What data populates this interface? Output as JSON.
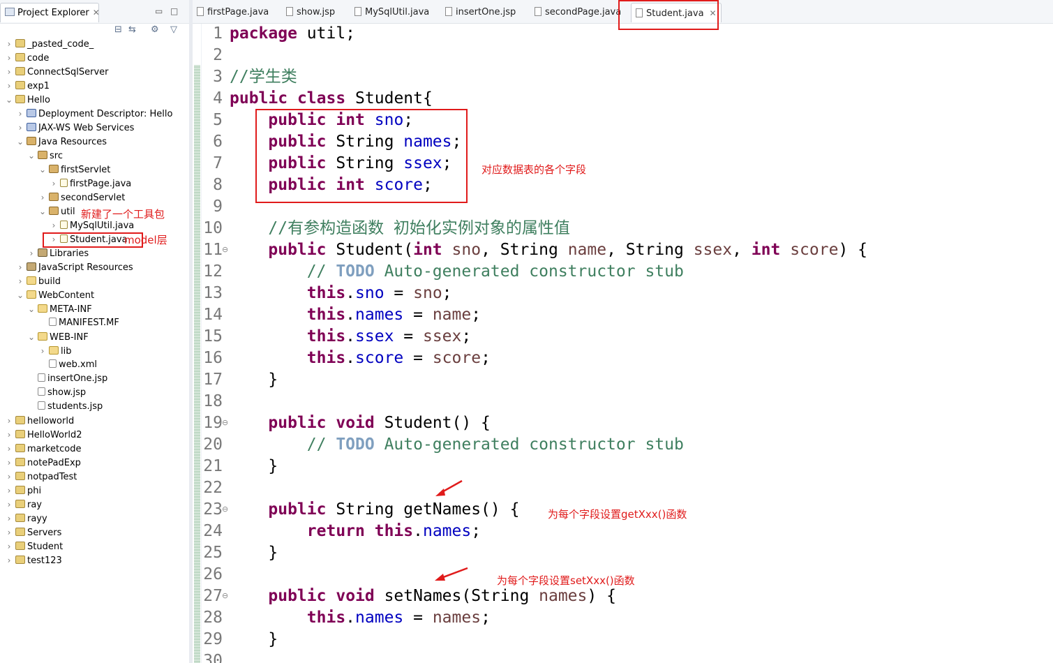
{
  "explorer": {
    "title": "Project Explorer",
    "tree": [
      {
        "label": "_pasted_code_",
        "depth": 0,
        "icon": "project-icon",
        "expanded": false
      },
      {
        "label": "code",
        "depth": 0,
        "icon": "project-icon",
        "expanded": false
      },
      {
        "label": "ConnectSqlServer",
        "depth": 0,
        "icon": "project-icon",
        "expanded": false
      },
      {
        "label": "exp1",
        "depth": 0,
        "icon": "project-icon",
        "expanded": false
      },
      {
        "label": "Hello",
        "depth": 0,
        "icon": "project-icon",
        "expanded": true
      },
      {
        "label": "Deployment Descriptor: Hello",
        "depth": 1,
        "icon": "descriptor-icon",
        "expanded": false
      },
      {
        "label": "JAX-WS Web Services",
        "depth": 1,
        "icon": "web-services-icon",
        "expanded": false
      },
      {
        "label": "Java Resources",
        "depth": 1,
        "icon": "java-resources-icon",
        "expanded": true
      },
      {
        "label": "src",
        "depth": 2,
        "icon": "source-folder-icon",
        "expanded": true
      },
      {
        "label": "firstServlet",
        "depth": 3,
        "icon": "package-icon",
        "expanded": true
      },
      {
        "label": "firstPage.java",
        "depth": 4,
        "icon": "java-file-icon",
        "expanded": false
      },
      {
        "label": "secondServlet",
        "depth": 3,
        "icon": "package-icon",
        "expanded": false
      },
      {
        "label": "util",
        "depth": 3,
        "icon": "package-icon",
        "expanded": true
      },
      {
        "label": "MySqlUtil.java",
        "depth": 4,
        "icon": "java-file-icon",
        "expanded": false
      },
      {
        "label": "Student.java",
        "depth": 4,
        "icon": "java-file-icon",
        "expanded": false
      },
      {
        "label": "Libraries",
        "depth": 2,
        "icon": "library-icon",
        "expanded": false
      },
      {
        "label": "JavaScript Resources",
        "depth": 1,
        "icon": "js-resources-icon",
        "expanded": false
      },
      {
        "label": "build",
        "depth": 1,
        "icon": "folder-icon",
        "expanded": false
      },
      {
        "label": "WebContent",
        "depth": 1,
        "icon": "folder-icon",
        "expanded": true
      },
      {
        "label": "META-INF",
        "depth": 2,
        "icon": "folder-icon",
        "expanded": true
      },
      {
        "label": "MANIFEST.MF",
        "depth": 3,
        "icon": "file-icon",
        "expanded": null
      },
      {
        "label": "WEB-INF",
        "depth": 2,
        "icon": "folder-icon",
        "expanded": true
      },
      {
        "label": "lib",
        "depth": 3,
        "icon": "folder-icon",
        "expanded": false
      },
      {
        "label": "web.xml",
        "depth": 3,
        "icon": "xml-file-icon",
        "expanded": null
      },
      {
        "label": "insertOne.jsp",
        "depth": 2,
        "icon": "jsp-file-icon",
        "expanded": null
      },
      {
        "label": "show.jsp",
        "depth": 2,
        "icon": "jsp-file-icon",
        "expanded": null
      },
      {
        "label": "students.jsp",
        "depth": 2,
        "icon": "jsp-file-icon",
        "expanded": null
      },
      {
        "label": "helloworld",
        "depth": 0,
        "icon": "project-icon",
        "expanded": false
      },
      {
        "label": "HelloWorld2",
        "depth": 0,
        "icon": "project-icon",
        "expanded": false
      },
      {
        "label": "marketcode",
        "depth": 0,
        "icon": "project-icon",
        "expanded": false
      },
      {
        "label": "notePadExp",
        "depth": 0,
        "icon": "project-icon",
        "expanded": false
      },
      {
        "label": "notpadTest",
        "depth": 0,
        "icon": "project-icon",
        "expanded": false
      },
      {
        "label": "phi",
        "depth": 0,
        "icon": "project-icon",
        "expanded": false
      },
      {
        "label": "ray",
        "depth": 0,
        "icon": "project-icon",
        "expanded": false
      },
      {
        "label": "rayy",
        "depth": 0,
        "icon": "project-icon",
        "expanded": false
      },
      {
        "label": "Servers",
        "depth": 0,
        "icon": "project-icon",
        "expanded": false
      },
      {
        "label": "Student",
        "depth": 0,
        "icon": "project-icon",
        "expanded": false
      },
      {
        "label": "test123",
        "depth": 0,
        "icon": "project-icon",
        "expanded": false
      }
    ],
    "annotations": {
      "util_note": "新建了一个工具包",
      "model_note": "model层"
    }
  },
  "editor": {
    "tabs": [
      {
        "label": "firstPage.java",
        "active": false
      },
      {
        "label": "show.jsp",
        "active": false
      },
      {
        "label": "MySqlUtil.java",
        "active": false
      },
      {
        "label": "insertOne.jsp",
        "active": false
      },
      {
        "label": "secondPage.java",
        "active": false
      },
      {
        "label": "Student.java",
        "active": true
      }
    ],
    "code_lines": [
      [
        {
          "t": "package",
          "c": "kw"
        },
        {
          "t": " util;",
          "c": ""
        }
      ],
      [],
      [
        {
          "t": "//学生类",
          "c": "cm"
        }
      ],
      [
        {
          "t": "public",
          "c": "kw"
        },
        {
          "t": " ",
          "c": ""
        },
        {
          "t": "class",
          "c": "kw"
        },
        {
          "t": " Student{",
          "c": ""
        }
      ],
      [
        {
          "t": "    ",
          "c": ""
        },
        {
          "t": "public",
          "c": "kw"
        },
        {
          "t": " ",
          "c": ""
        },
        {
          "t": "int",
          "c": "kw"
        },
        {
          "t": " ",
          "c": ""
        },
        {
          "t": "sno",
          "c": "fld"
        },
        {
          "t": ";",
          "c": ""
        }
      ],
      [
        {
          "t": "    ",
          "c": ""
        },
        {
          "t": "public",
          "c": "kw"
        },
        {
          "t": " String ",
          "c": ""
        },
        {
          "t": "names",
          "c": "fld"
        },
        {
          "t": ";",
          "c": ""
        }
      ],
      [
        {
          "t": "    ",
          "c": ""
        },
        {
          "t": "public",
          "c": "kw"
        },
        {
          "t": " String ",
          "c": ""
        },
        {
          "t": "ssex",
          "c": "fld"
        },
        {
          "t": ";",
          "c": ""
        }
      ],
      [
        {
          "t": "    ",
          "c": ""
        },
        {
          "t": "public",
          "c": "kw"
        },
        {
          "t": " ",
          "c": ""
        },
        {
          "t": "int",
          "c": "kw"
        },
        {
          "t": " ",
          "c": ""
        },
        {
          "t": "score",
          "c": "fld"
        },
        {
          "t": ";",
          "c": ""
        }
      ],
      [],
      [
        {
          "t": "    ",
          "c": ""
        },
        {
          "t": "//有参构造函数 初始化实例对象的属性值",
          "c": "cm"
        }
      ],
      [
        {
          "t": "    ",
          "c": ""
        },
        {
          "t": "public",
          "c": "kw"
        },
        {
          "t": " Student(",
          "c": ""
        },
        {
          "t": "int",
          "c": "kw"
        },
        {
          "t": " ",
          "c": ""
        },
        {
          "t": "sno",
          "c": "var"
        },
        {
          "t": ", String ",
          "c": ""
        },
        {
          "t": "name",
          "c": "var"
        },
        {
          "t": ", String ",
          "c": ""
        },
        {
          "t": "ssex",
          "c": "var"
        },
        {
          "t": ", ",
          "c": ""
        },
        {
          "t": "int",
          "c": "kw"
        },
        {
          "t": " ",
          "c": ""
        },
        {
          "t": "score",
          "c": "var"
        },
        {
          "t": ") {",
          "c": ""
        }
      ],
      [
        {
          "t": "        ",
          "c": ""
        },
        {
          "t": "// ",
          "c": "cm"
        },
        {
          "t": "TODO",
          "c": "todo"
        },
        {
          "t": " Auto-generated constructor stub",
          "c": "cm"
        }
      ],
      [
        {
          "t": "        ",
          "c": ""
        },
        {
          "t": "this",
          "c": "kw"
        },
        {
          "t": ".",
          "c": ""
        },
        {
          "t": "sno",
          "c": "fld"
        },
        {
          "t": " = ",
          "c": ""
        },
        {
          "t": "sno",
          "c": "var"
        },
        {
          "t": ";",
          "c": ""
        }
      ],
      [
        {
          "t": "        ",
          "c": ""
        },
        {
          "t": "this",
          "c": "kw"
        },
        {
          "t": ".",
          "c": ""
        },
        {
          "t": "names",
          "c": "fld"
        },
        {
          "t": " = ",
          "c": ""
        },
        {
          "t": "name",
          "c": "var"
        },
        {
          "t": ";",
          "c": ""
        }
      ],
      [
        {
          "t": "        ",
          "c": ""
        },
        {
          "t": "this",
          "c": "kw"
        },
        {
          "t": ".",
          "c": ""
        },
        {
          "t": "ssex",
          "c": "fld"
        },
        {
          "t": " = ",
          "c": ""
        },
        {
          "t": "ssex",
          "c": "var"
        },
        {
          "t": ";",
          "c": ""
        }
      ],
      [
        {
          "t": "        ",
          "c": ""
        },
        {
          "t": "this",
          "c": "kw"
        },
        {
          "t": ".",
          "c": ""
        },
        {
          "t": "score",
          "c": "fld"
        },
        {
          "t": " = ",
          "c": ""
        },
        {
          "t": "score",
          "c": "var"
        },
        {
          "t": ";",
          "c": ""
        }
      ],
      [
        {
          "t": "    }",
          "c": ""
        }
      ],
      [],
      [
        {
          "t": "    ",
          "c": ""
        },
        {
          "t": "public",
          "c": "kw"
        },
        {
          "t": " ",
          "c": ""
        },
        {
          "t": "void",
          "c": "kw"
        },
        {
          "t": " Student() {",
          "c": ""
        }
      ],
      [
        {
          "t": "        ",
          "c": ""
        },
        {
          "t": "// ",
          "c": "cm"
        },
        {
          "t": "TODO",
          "c": "todo"
        },
        {
          "t": " Auto-generated constructor stub",
          "c": "cm"
        }
      ],
      [
        {
          "t": "    }",
          "c": ""
        }
      ],
      [],
      [
        {
          "t": "    ",
          "c": ""
        },
        {
          "t": "public",
          "c": "kw"
        },
        {
          "t": " String getNames() {",
          "c": ""
        }
      ],
      [
        {
          "t": "        ",
          "c": ""
        },
        {
          "t": "return",
          "c": "kw"
        },
        {
          "t": " ",
          "c": ""
        },
        {
          "t": "this",
          "c": "kw"
        },
        {
          "t": ".",
          "c": ""
        },
        {
          "t": "names",
          "c": "fld"
        },
        {
          "t": ";",
          "c": ""
        }
      ],
      [
        {
          "t": "    }",
          "c": ""
        }
      ],
      [],
      [
        {
          "t": "    ",
          "c": ""
        },
        {
          "t": "public",
          "c": "kw"
        },
        {
          "t": " ",
          "c": ""
        },
        {
          "t": "void",
          "c": "kw"
        },
        {
          "t": " setNames(String ",
          "c": ""
        },
        {
          "t": "names",
          "c": "var"
        },
        {
          "t": ") {",
          "c": ""
        }
      ],
      [
        {
          "t": "        ",
          "c": ""
        },
        {
          "t": "this",
          "c": "kw"
        },
        {
          "t": ".",
          "c": ""
        },
        {
          "t": "names",
          "c": "fld"
        },
        {
          "t": " = ",
          "c": ""
        },
        {
          "t": "names",
          "c": "var"
        },
        {
          "t": ";",
          "c": ""
        }
      ],
      [
        {
          "t": "    }",
          "c": ""
        }
      ],
      []
    ],
    "annotations": {
      "fields_note": "对应数据表的各个字段",
      "getter_note": "为每个字段设置getXxx()函数",
      "setter_note": "为每个字段设置setXxx()函数"
    },
    "colors": {
      "keyword": "#7f0055",
      "field": "#0000c0",
      "comment": "#3f7f5f",
      "annotation": "#e01b1b"
    }
  }
}
